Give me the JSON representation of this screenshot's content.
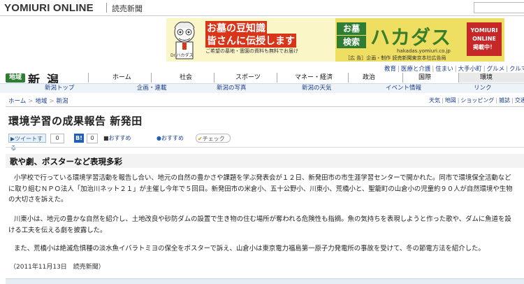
{
  "header": {
    "logo": "YOMIURI ONLINE",
    "logo_ja": "読売新聞"
  },
  "banner": {
    "headline1": "お墓の豆知識",
    "headline2": "皆さんに伝授します",
    "sub": "ご希望の墓地・霊園の資料も無料でお届け",
    "mascot_label": "Dr.ハカダス",
    "ohaka": "お墓",
    "kensaku": "検索",
    "hakadas": "ハカダス",
    "url": "hakadas.yomiuri.co.jp",
    "credit": "［広 告］企画・制作 読売新聞東京本社広告局",
    "yomiuri_line1": "YOMIURI",
    "yomiuri_line2": "ONLINE",
    "yomiuri_line3": "掲載中！"
  },
  "util_links": [
    "教育",
    "医療と介護",
    "住まい",
    "大手小町",
    "グルメ",
    "クルマ"
  ],
  "region": {
    "badge": "地域",
    "title": "新 潟"
  },
  "nav": [
    "ホーム",
    "社会",
    "スポーツ",
    "マネー・経済",
    "政治",
    "国際",
    "環境"
  ],
  "subnav": [
    "新潟トップ",
    "企画・連載",
    "新潟の写真",
    "新潟の天気",
    "イベント情報",
    "リンク"
  ],
  "breadcrumb": [
    "ホーム",
    "地域",
    "新潟"
  ],
  "side_links": [
    "天気",
    "地図",
    "ショッピング",
    "雑誌",
    "交通"
  ],
  "article": {
    "headline": "環境学習の成果報告 新発田",
    "tweet_label": "ツイートする",
    "tweet_count": "0",
    "hatena_label": "B!",
    "hatena_count": "0",
    "osusume1": "おすすめ",
    "osusume2": "おすすめ",
    "check": "チェック",
    "subhead": "歌や劇、ポスターなど表現多彩",
    "p1": "小学校で行っている環境学習活動を報告し合い、地元の自然の豊かさや課題を学ぶ発表会が１２日、新発田市の市生涯学習センターで開かれた。同市で環境保全活動などに取り組むＮＰＯ法人「加治川ネット２１」が主催し今年で５回目。新発田市の米倉小、五十公野小、川東小、荒橋小と、聖籠町の山倉小の児童約９０人が自然環境や生物の大切さを訴えた。",
    "p2": "川東小は、地元の豊かな自然を紹介し、土地改良や砂防ダムの設置で生き物の住む場所が奪われる危険性も指摘。魚の気持ちを表現しようと作った歌や、ダムに魚道を設ける工夫を伝える劇を披露した。",
    "p3": "また、荒橋小は絶滅危惧種の淡水魚イバラトミヨの保全をポスターで訴え、山倉小は東京電力福島第一原子力発電所の事故を受けて、冬の節電方法を紹介した。",
    "dateline": "（2011年11月13日　読売新聞）"
  },
  "colors": {
    "link": "#1a3d8f",
    "badge_green": "#2e7d32",
    "banner_red": "#d8351a"
  }
}
